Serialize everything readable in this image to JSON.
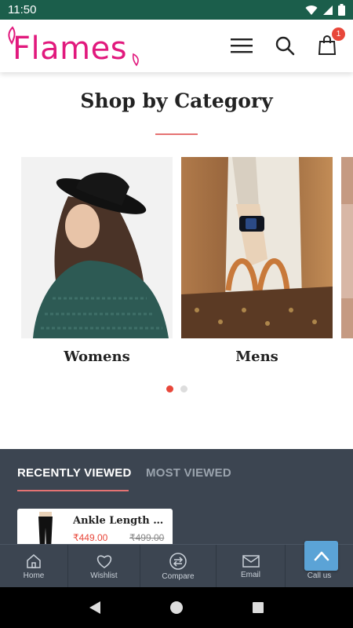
{
  "status_bar": {
    "time": "11:50"
  },
  "header": {
    "logo_text": "Flames",
    "cart_count": "1",
    "brand_color": "#e1197d"
  },
  "category": {
    "title": "Shop by Category",
    "items": [
      {
        "label": "Womens"
      },
      {
        "label": "Mens"
      }
    ],
    "active_dot": 0,
    "dot_count": 2
  },
  "recent": {
    "tabs": [
      {
        "label": "RECENTLY VIEWED",
        "active": true
      },
      {
        "label": "MOST VIEWED",
        "active": false
      }
    ],
    "products": [
      {
        "name": "Ankle Length Leggings",
        "price": "₹449.00",
        "old_price": "₹499.00"
      }
    ]
  },
  "bottom_nav": {
    "items": [
      {
        "label": "Home",
        "icon": "home-icon"
      },
      {
        "label": "Wishlist",
        "icon": "heart-icon"
      },
      {
        "label": "Compare",
        "icon": "compare-icon"
      },
      {
        "label": "Email",
        "icon": "mail-icon"
      },
      {
        "label": "Call us",
        "icon": "phone-icon"
      }
    ]
  },
  "colors": {
    "accent": "#e8473a",
    "dark_panel": "#3c4551",
    "status_bar": "#1b5e4b",
    "scroll_button": "#5ba3d6"
  }
}
